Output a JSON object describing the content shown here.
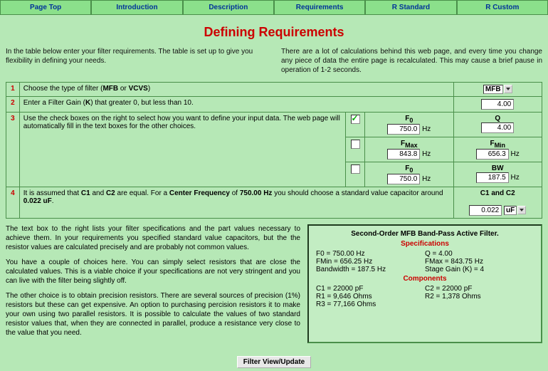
{
  "nav": [
    "Page Top",
    "Introduction",
    "Description",
    "Requirements",
    "R Standard",
    "R Custom"
  ],
  "title": "Defining Requirements",
  "intro_left": "In the table below enter your filter requirements. The table is set up to give you flexibility in defining your needs.",
  "intro_right": "There are a lot of calculations behind this web page, and every time you change any piece of data the entire page is recalculated. This may cause a brief pause in operation of 1-2 seconds.",
  "rows": {
    "r1_num": "1",
    "r1_text": "Choose the type of filter (MFB or VCVS)",
    "r1_sel": "MFB",
    "r2_num": "2",
    "r2_text": "Enter a Filter Gain (K) that greater 0, but less than 10.",
    "r2_val": "4.00",
    "r3_num": "3",
    "r3_text": "Use the check boxes on the right to select how you want to define your input data. The web page will automatically fill in the text boxes for the other choices.",
    "r3a_l_lbl": "F",
    "r3a_l_sub": "0",
    "r3a_l_val": "750.0",
    "r3a_l_unit": "Hz",
    "r3a_r_lbl": "Q",
    "r3a_r_val": "4.00",
    "r3b_l_lbl": "F",
    "r3b_l_sub": "Max",
    "r3b_l_val": "843.8",
    "r3b_l_unit": "Hz",
    "r3b_r_lbl": "F",
    "r3b_r_sub": "Min",
    "r3b_r_val": "656.3",
    "r3b_r_unit": "Hz",
    "r3c_l_lbl": "F",
    "r3c_l_sub": "0",
    "r3c_l_val": "750.0",
    "r3c_l_unit": "Hz",
    "r3c_r_lbl": "BW",
    "r3c_r_val": "187.5",
    "r3c_r_unit": "Hz",
    "r4_num": "4",
    "r4_text_a": "It is assumed that ",
    "r4_text_b": "C1",
    "r4_text_c": " and ",
    "r4_text_d": "C2",
    "r4_text_e": " are equal. For a ",
    "r4_text_f": "Center Frequency",
    "r4_text_g": " of ",
    "r4_text_h": "750.00 Hz",
    "r4_text_i": " you should choose a standard value capacitor around ",
    "r4_text_j": "0.022 uF",
    "r4_text_k": ".",
    "r4_lbl": "C1 and C2",
    "r4_val": "0.022",
    "r4_unit": "uF"
  },
  "left_paras": [
    "The text box to the right lists your filter specifications and the part values necessary to achieve them. In your requirements you specified standard value capacitors, but the the resistor values are calculated precisely and are probably not common values.",
    "You have a couple of choices here. You can simply select resistors that are close the calculated values. This is a viable choice if your specifications are not very stringent and you can live with the filter being slightly off.",
    "The other choice is to obtain precision resistors. There are several sources of precision (1%) resistors but these can get expensive. An option to purchasing percision resistors it to make your own using two parallel resistors. It is possible to calculate the values of two standard resistor values that, when they are connected in parallel, produce a resistance very close to the value that you need."
  ],
  "spec": {
    "title": "Second-Order MFB Band-Pass Active Filter.",
    "sub1": "Specifications",
    "l1a": "F0 = 750.00 Hz",
    "l1b": "Q = 4.00",
    "l2a": "FMin = 656.25 Hz",
    "l2b": "FMax = 843.75 Hz",
    "l3a": "Bandwidth = 187.5 Hz",
    "l3b": "Stage Gain (K) = 4",
    "sub2": "Components",
    "l4a": "C1 = 22000 pF",
    "l4b": "C2 = 22000 pF",
    "l5a": "R1 = 9,646 Ohms",
    "l5b": "R2 = 1,378 Ohms",
    "l6a": "R3 = 77,166 Ohms"
  },
  "btn": "Filter View/Update"
}
